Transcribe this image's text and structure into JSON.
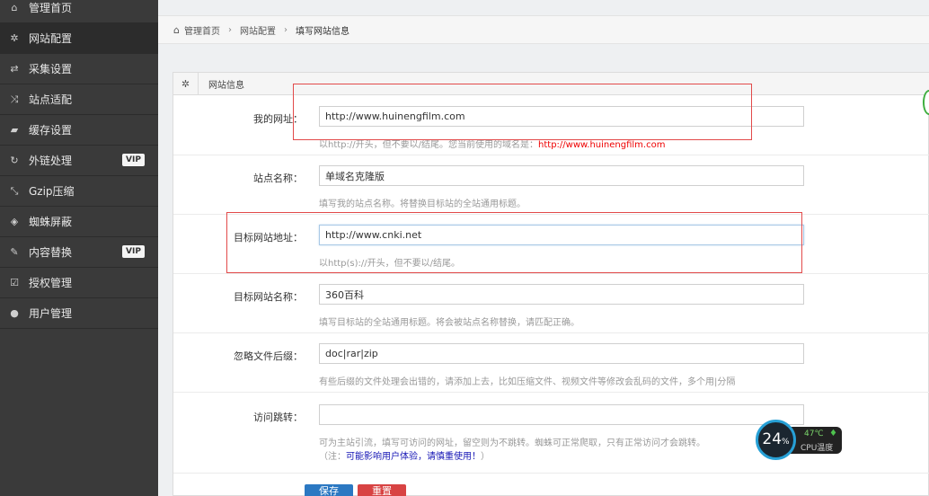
{
  "sidebar": {
    "items": [
      {
        "label": "管理首页",
        "icon": "home-icon",
        "glyph": "⌂"
      },
      {
        "label": "网站配置",
        "icon": "gear-icon",
        "glyph": "✲"
      },
      {
        "label": "采集设置",
        "icon": "retweet-icon",
        "glyph": "⇄"
      },
      {
        "label": "站点适配",
        "icon": "shuffle-icon",
        "glyph": "⤨"
      },
      {
        "label": "缓存设置",
        "icon": "folder-open-icon",
        "glyph": "▰"
      },
      {
        "label": "外链处理",
        "icon": "refresh-icon",
        "glyph": "↻",
        "badge": "VIP"
      },
      {
        "label": "Gzip压缩",
        "icon": "compress-icon",
        "glyph": "⤡"
      },
      {
        "label": "蜘蛛屏蔽",
        "icon": "eye-slash-icon",
        "glyph": "◈"
      },
      {
        "label": "内容替换",
        "icon": "pencil-icon",
        "glyph": "✎",
        "badge": "VIP"
      },
      {
        "label": "授权管理",
        "icon": "check-square-icon",
        "glyph": "☑"
      },
      {
        "label": "用户管理",
        "icon": "user-icon",
        "glyph": "●"
      }
    ]
  },
  "breadcrumb": {
    "home": "管理首页",
    "section": "网站配置",
    "current": "填写网站信息"
  },
  "panel": {
    "title": "网站信息"
  },
  "form": {
    "my_url": {
      "label": "我的网址：",
      "value": "http://www.huinengfilm.com",
      "hint_prefix": "以http://开头，但不要以/结尾。您当前使用的域名是：",
      "hint_domain": "http://www.huinengfilm.com"
    },
    "site_name": {
      "label": "站点名称：",
      "value": "单域名克隆版",
      "hint": "填写我的站点名称。将替换目标站的全站通用标题。"
    },
    "target_url": {
      "label": "目标网站地址：",
      "value": "http://www.cnki.net",
      "hint": "以http(s)://开头，但不要以/结尾。"
    },
    "target_name": {
      "label": "目标网站名称：",
      "value": "360百科",
      "hint": "填写目标站的全站通用标题。将会被站点名称替换，请匹配正确。"
    },
    "ignore_ext": {
      "label": "忽略文件后缀：",
      "value": "doc|rar|zip",
      "hint": "有些后缀的文件处理会出错的，请添加上去，比如压缩文件、视频文件等修改会乱码的文件，多个用|分隔"
    },
    "redirect": {
      "label": "访问跳转：",
      "value": "",
      "hint": "可为主站引流，填写可访问的网址，留空则为不跳转。蜘蛛可正常爬取，只有正常访问才会跳转。",
      "note_prefix": "（注：",
      "note_warn": "可能影响用户体验，请慎重使用！",
      "note_suffix": "）"
    }
  },
  "buttons": {
    "save": "保存",
    "reset": "重置"
  },
  "cpu_widget": {
    "usage": "24",
    "unit": "%",
    "temp": "47℃",
    "label": "CPU温度"
  },
  "colors": {
    "sidebar_bg": "#3a3a3a",
    "accent_blue": "#2b78c2",
    "danger_red": "#d84343",
    "annotation_red": "#e24a4a"
  }
}
